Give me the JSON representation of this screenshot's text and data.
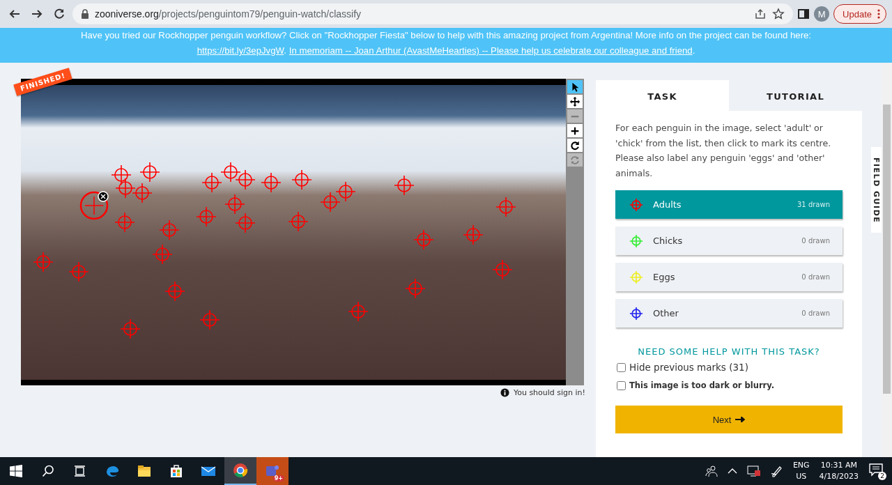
{
  "browser": {
    "url_host": "zooniverse.org",
    "url_path": "/projects/penguintom79/penguin-watch/classify",
    "profile_initial": "M",
    "update_label": "Update"
  },
  "banner": [
    {
      "kind": "plain",
      "text": "Have you tried our Rockhopper penguin workflow? Click on \"Rockhopper Fiesta\" below to help with this amazing project from Argentina! More info on the project can be found here:"
    },
    {
      "kind": "link",
      "text": "https://bit.ly/3epJvgW"
    },
    {
      "kind": "plain",
      "text": "."
    },
    {
      "kind": "link",
      "text": "In memoriam -- Joan Arthur (AvastMeHearties) -- Please help us celebrate our colleague and friend"
    },
    {
      "kind": "plain",
      "text": "."
    }
  ],
  "subject": {
    "badge": "FINISHED!",
    "notice": "You should sign in!",
    "tools": [
      {
        "kind": "pointer",
        "selected": true,
        "disabled": false
      },
      {
        "kind": "move",
        "selected": false,
        "disabled": false
      },
      {
        "kind": "zoom-out",
        "selected": false,
        "disabled": true
      },
      {
        "kind": "zoom-in",
        "selected": false,
        "disabled": false
      },
      {
        "kind": "rotate",
        "selected": false,
        "disabled": false
      },
      {
        "kind": "reset",
        "selected": false,
        "disabled": true
      }
    ]
  },
  "tabs": [
    {
      "label": "TASK",
      "selected": true
    },
    {
      "label": "TUTORIAL",
      "selected": false
    }
  ],
  "instruction": "For each penguin in the image, select 'adult' or 'chick' from the list, then click to mark its centre. Please also label any penguin 'eggs' and 'other' animals.",
  "task_tools": [
    {
      "label": "Adults",
      "count": "31 drawn",
      "color": "#ff0000",
      "selected": true
    },
    {
      "label": "Chicks",
      "count": "0 drawn",
      "color": "#33ee33",
      "selected": false
    },
    {
      "label": "Eggs",
      "count": "0 drawn",
      "color": "#eeee22",
      "selected": false
    },
    {
      "label": "Other",
      "count": "0 drawn",
      "color": "#2222ee",
      "selected": false
    }
  ],
  "help_heading": "NEED SOME HELP WITH THIS TASK?",
  "options": [
    {
      "kind": "normal",
      "label": "Hide previous marks (31)",
      "checked": false
    },
    {
      "kind": "bold",
      "label": "This image is too dark or blurry.",
      "checked": false
    }
  ],
  "next_button": "Next",
  "field_guide": "FIELD GUIDE",
  "taskbar": {
    "apps": [
      {
        "kind": "edge",
        "selected": false
      },
      {
        "kind": "files",
        "selected": false
      },
      {
        "kind": "store",
        "selected": false
      },
      {
        "kind": "mail",
        "selected": false
      },
      {
        "kind": "chrome",
        "selected": true
      },
      {
        "kind": "teams",
        "selected": false,
        "badge": "9+"
      }
    ],
    "language": "ENG",
    "region": "US",
    "time": "10:31 AM",
    "date": "4/18/2023",
    "notifications": "2"
  }
}
